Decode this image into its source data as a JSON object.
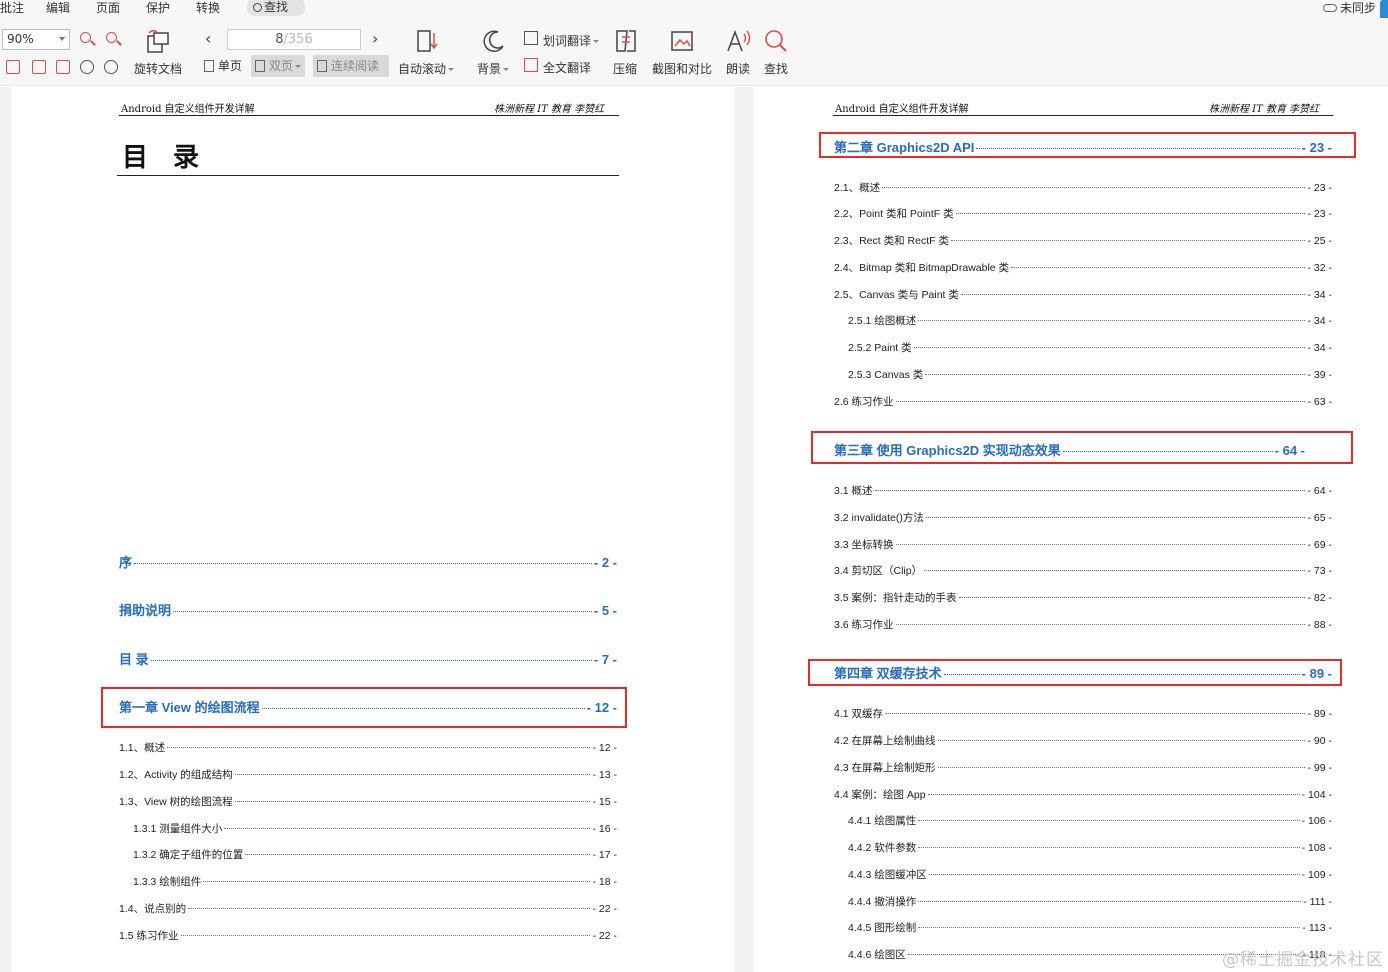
{
  "menu": [
    "批注",
    "编辑",
    "页面",
    "保护",
    "转换"
  ],
  "search_chip": "查找",
  "sync_status": "未同步",
  "toolbar": {
    "zoom": "90%",
    "rotate": "旋转文档",
    "page_current": "8",
    "page_total": "/356",
    "prev": "‹",
    "next": "›",
    "single": "单页",
    "double": "双页",
    "continuous": "连续阅读",
    "autoscroll": "自动滚动",
    "background": "背景",
    "word_translate": "划词翻译",
    "full_translate": "全文翻译",
    "compress": "压缩",
    "screenshot_compare": "截图和对比",
    "read_aloud": "朗读",
    "find": "查找"
  },
  "left_page": {
    "header_left": "Android 自定义组件开发详解",
    "header_right": "株洲新程 IT 教育    李赞红",
    "title": "目 录",
    "chapters": [
      {
        "title": "序",
        "page": "- 2 -"
      },
      {
        "title": "捐助说明",
        "page": "- 5 -"
      },
      {
        "title": "目 录",
        "page": "- 7 -"
      },
      {
        "title": "第一章    View 的绘图流程",
        "page": "- 12 -"
      }
    ],
    "entries": [
      {
        "title": "1.1、概述",
        "page": "- 12 -"
      },
      {
        "title": "1.2、Activity 的组成结构",
        "page": "- 13 -"
      },
      {
        "title": "1.3、View 树的绘图流程",
        "page": "- 15 -"
      },
      {
        "title": "1.3.1  测量组件大小",
        "page": "- 16 -"
      },
      {
        "title": "1.3.2  确定子组件的位置",
        "page": "- 17 -"
      },
      {
        "title": "1.3.3  绘制组件",
        "page": "- 18 -"
      },
      {
        "title": "1.4、说点别的",
        "page": "- 22 -"
      },
      {
        "title": "1.5  练习作业",
        "page": "- 22 -"
      }
    ]
  },
  "right_page": {
    "header_left": "Android 自定义组件开发详解",
    "header_right": "株洲新程 IT 教育    李赞红",
    "chapter2": {
      "title": "第二章    Graphics2D API",
      "page": "- 23 -"
    },
    "ch2_entries": [
      {
        "title": "2.1、概述",
        "page": "- 23 -"
      },
      {
        "title": "2.2、Point 类和 PointF 类",
        "page": "- 23 -"
      },
      {
        "title": "2.3、Rect 类和 RectF 类",
        "page": "- 25 -"
      },
      {
        "title": "2.4、Bitmap 类和 BitmapDrawable 类",
        "page": "- 32 -"
      },
      {
        "title": "2.5、Canvas 类与 Paint 类",
        "page": "- 34 -"
      },
      {
        "title": "2.5.1  绘图概述",
        "page": "- 34 -"
      },
      {
        "title": "2.5.2 Paint 类",
        "page": "- 34 -"
      },
      {
        "title": "2.5.3 Canvas 类",
        "page": "- 39 -"
      },
      {
        "title": "2.6  练习作业",
        "page": "- 63 -"
      }
    ],
    "chapter3": {
      "title": "第三章    使用 Graphics2D 实现动态效果",
      "page": "- 64 -"
    },
    "ch3_entries": [
      {
        "title": "3.1  概述",
        "page": "- 64 -"
      },
      {
        "title": "3.2 invalidate()方法",
        "page": "- 65 -"
      },
      {
        "title": "3.3  坐标转换",
        "page": "- 69 -"
      },
      {
        "title": "3.4  剪切区（Clip）",
        "page": "- 73 -"
      },
      {
        "title": "3.5  案例：指针走动的手表",
        "page": "- 82 -"
      },
      {
        "title": "3.6  练习作业",
        "page": "- 88 -"
      }
    ],
    "chapter4": {
      "title": "第四章    双缓存技术",
      "page": "- 89 -"
    },
    "ch4_entries": [
      {
        "title": "4.1  双缓存",
        "page": "- 89 -"
      },
      {
        "title": "4.2  在屏幕上绘制曲线",
        "page": "- 90 -"
      },
      {
        "title": "4.3  在屏幕上绘制矩形",
        "page": "- 99 -"
      },
      {
        "title": "4.4  案例：绘图 App",
        "page": "- 104 -"
      },
      {
        "title": "4.4.1  绘图属性",
        "page": "- 106 -"
      },
      {
        "title": "4.4.2  软件参数",
        "page": "- 108 -"
      },
      {
        "title": "4.4.3  绘图缓冲区",
        "page": "- 109 -"
      },
      {
        "title": "4.4.4  撤消操作",
        "page": "- 111 -"
      },
      {
        "title": "4.4.5  图形绘制",
        "page": "- 113 -"
      },
      {
        "title": "4.4.6  绘图区",
        "page": "- 118 -"
      }
    ]
  },
  "watermark": "@稀土掘金技术社区",
  "colors": {
    "chapter_blue": "#2a6cb6",
    "highlight_red": "#e22b2b"
  }
}
